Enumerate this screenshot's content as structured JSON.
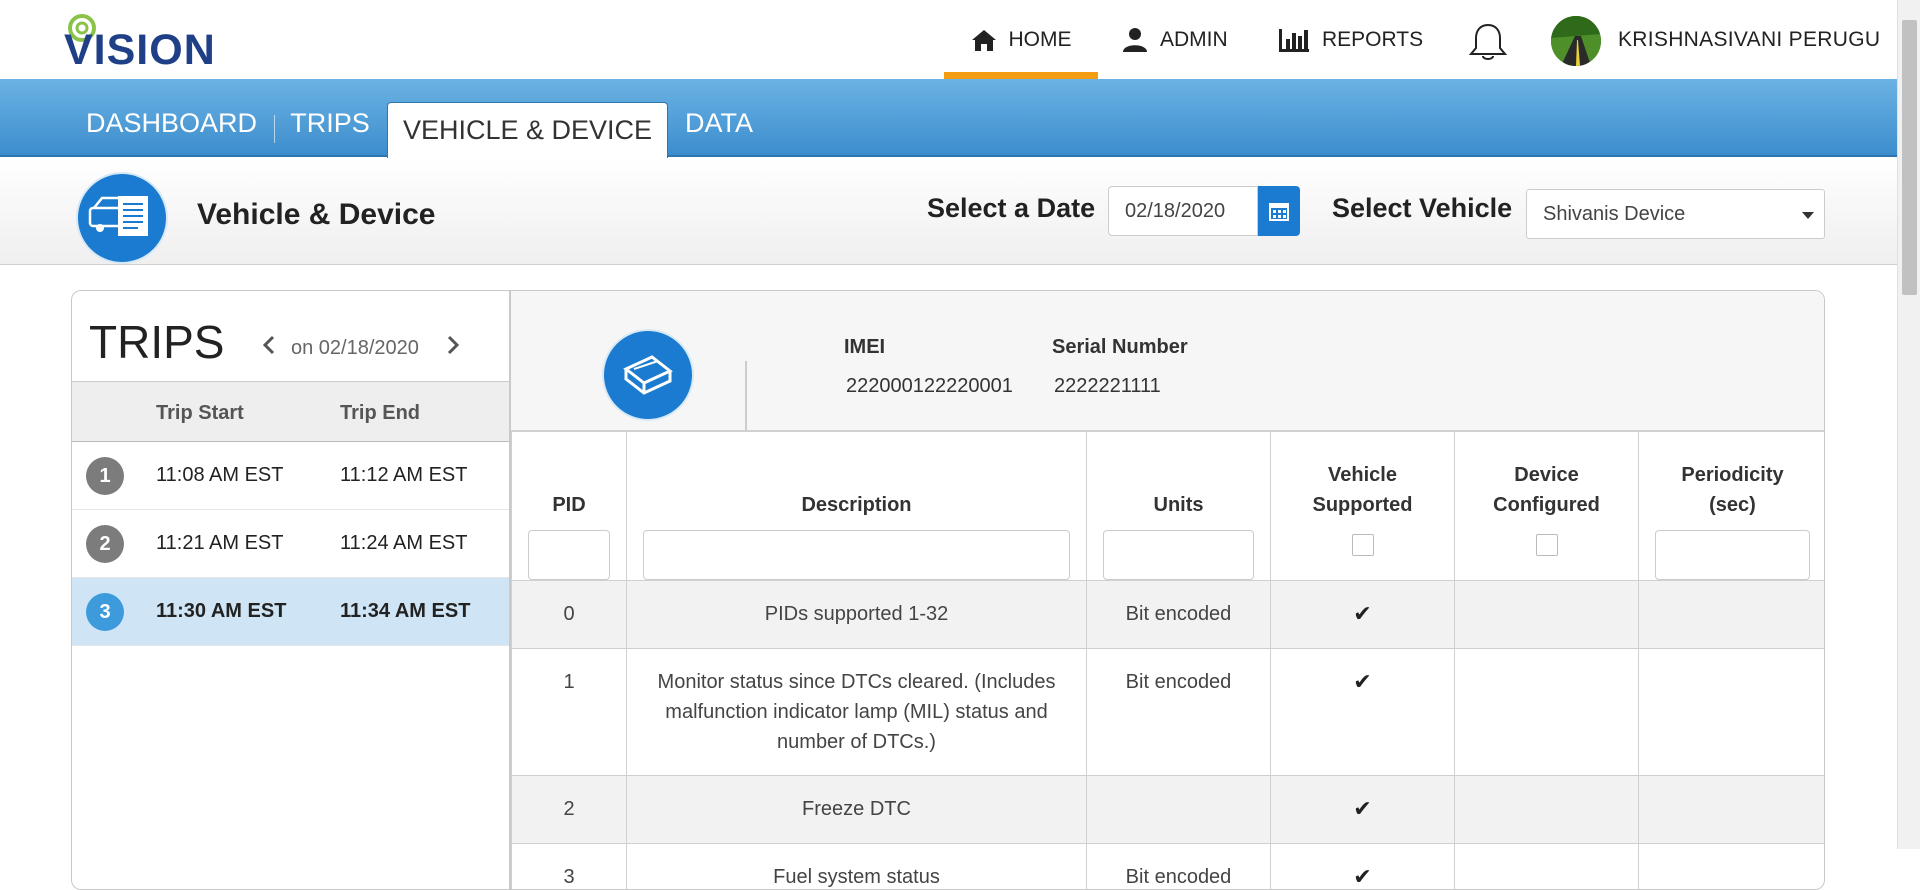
{
  "brand": {
    "logo_text": "VISION",
    "accent": "#1f3f87",
    "ring_color": "#8bc34a"
  },
  "nav": {
    "home": "HOME",
    "admin": "ADMIN",
    "reports": "REPORTS",
    "username": "KRISHNASIVANI PERUGU",
    "active_underline": "#f39c12"
  },
  "tabs": [
    "DASHBOARD",
    "TRIPS",
    "VEHICLE & DEVICE",
    "DATA"
  ],
  "active_tab": "VEHICLE & DEVICE",
  "header": {
    "title": "Vehicle & Device",
    "date_label": "Select a Date",
    "date_value": "02/18/2020",
    "vehicle_label": "Select Vehicle",
    "vehicle_value": "Shivanis Device"
  },
  "trips": {
    "title": "TRIPS",
    "date_text": "on 02/18/2020",
    "col_start": "Trip Start",
    "col_end": "Trip End",
    "rows": [
      {
        "num": "1",
        "start": "11:08 AM EST",
        "end": "11:12 AM EST",
        "selected": false
      },
      {
        "num": "2",
        "start": "11:21 AM EST",
        "end": "11:24 AM EST",
        "selected": false
      },
      {
        "num": "3",
        "start": "11:30 AM EST",
        "end": "11:34 AM EST",
        "selected": true
      }
    ]
  },
  "device": {
    "imei_label": "IMEI",
    "imei_value": "222000122220001",
    "serial_label": "Serial Number",
    "serial_value": "2222221111"
  },
  "pid_table": {
    "headers": {
      "pid": "PID",
      "description": "Description",
      "units": "Units",
      "vehicle_supported_1": "Vehicle",
      "vehicle_supported_2": "Supported",
      "device_configured_1": "Device",
      "device_configured_2": "Configured",
      "periodicity_1": "Periodicity",
      "periodicity_2": "(sec)"
    },
    "rows": [
      {
        "pid": "0",
        "description": "PIDs supported 1-32",
        "units": "Bit encoded",
        "vehicle_supported": true,
        "device_configured": false,
        "periodicity": ""
      },
      {
        "pid": "1",
        "description": "Monitor status since DTCs cleared. (Includes malfunction indicator lamp (MIL) status and number of DTCs.)",
        "units": "Bit encoded",
        "vehicle_supported": true,
        "device_configured": false,
        "periodicity": ""
      },
      {
        "pid": "2",
        "description": "Freeze DTC",
        "units": "",
        "vehicle_supported": true,
        "device_configured": false,
        "periodicity": ""
      },
      {
        "pid": "3",
        "description": "Fuel system status",
        "units": "Bit encoded",
        "vehicle_supported": true,
        "device_configured": false,
        "periodicity": ""
      }
    ],
    "check_glyph": "✔"
  }
}
